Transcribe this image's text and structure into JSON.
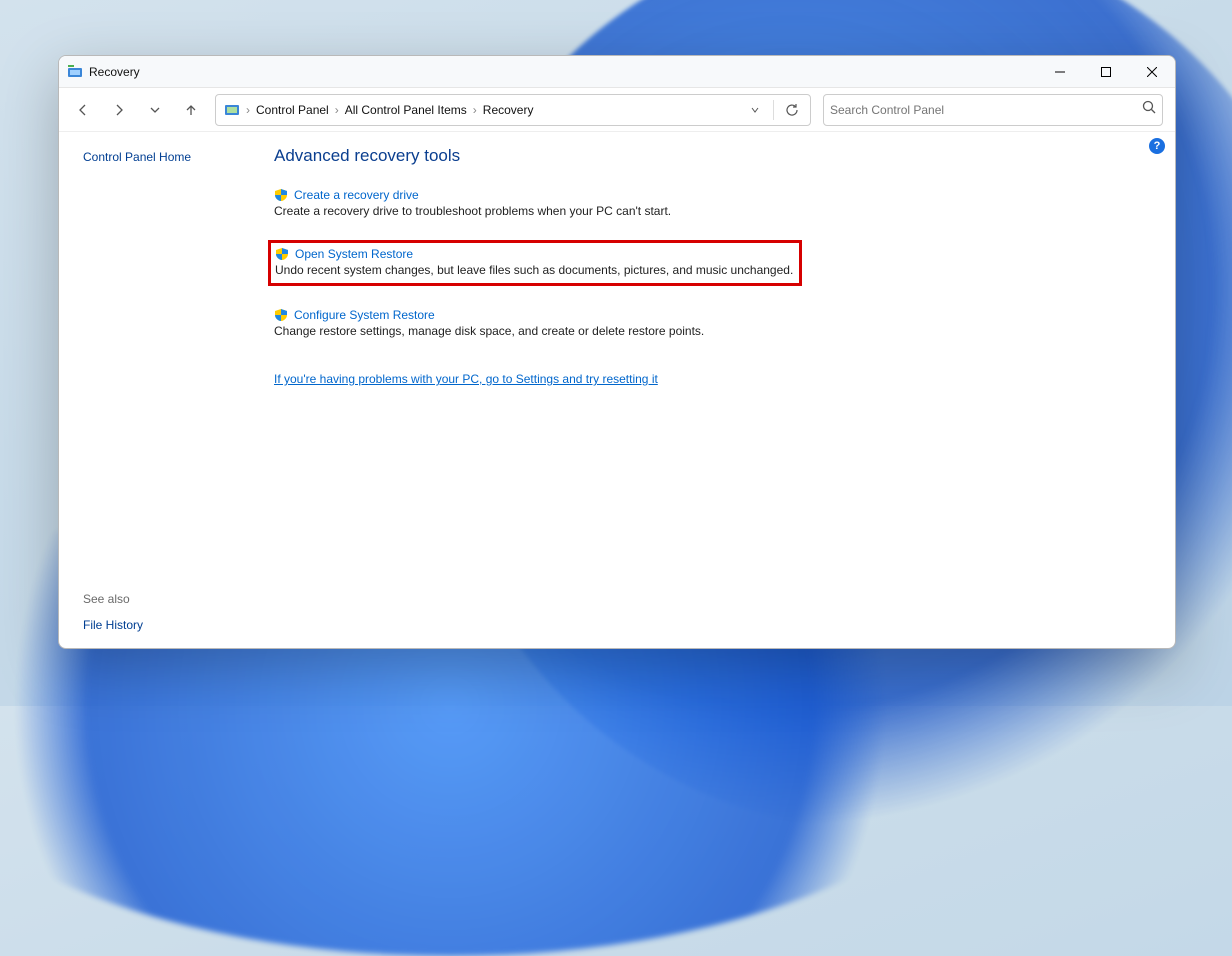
{
  "window": {
    "title": "Recovery"
  },
  "breadcrumb": {
    "item0": "Control Panel",
    "item1": "All Control Panel Items",
    "item2": "Recovery"
  },
  "search": {
    "placeholder": "Search Control Panel"
  },
  "sidebar": {
    "home": "Control Panel Home",
    "seealso": "See also",
    "filehistory": "File History"
  },
  "main": {
    "heading": "Advanced recovery tools",
    "items": [
      {
        "title": "Create a recovery drive",
        "desc": "Create a recovery drive to troubleshoot problems when your PC can't start."
      },
      {
        "title": "Open System Restore",
        "desc": "Undo recent system changes, but leave files such as documents, pictures, and music unchanged."
      },
      {
        "title": "Configure System Restore",
        "desc": "Change restore settings, manage disk space, and create or delete restore points."
      }
    ],
    "reset": "If you're having problems with your PC, go to Settings and try resetting it"
  },
  "help": "?"
}
